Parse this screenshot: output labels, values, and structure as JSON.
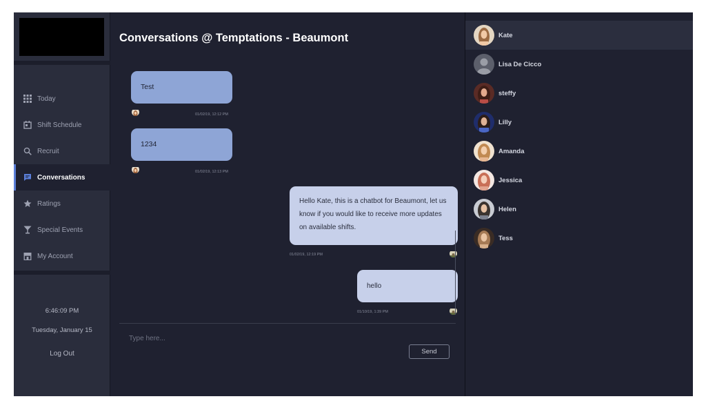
{
  "sidebar": {
    "nav": [
      {
        "label": "Today",
        "icon": "grid-icon"
      },
      {
        "label": "Shift Schedule",
        "icon": "calendar-icon"
      },
      {
        "label": "Recruit",
        "icon": "search-icon"
      },
      {
        "label": "Conversations",
        "icon": "chat-icon",
        "active": true
      },
      {
        "label": "Ratings",
        "icon": "star-icon"
      },
      {
        "label": "Special Events",
        "icon": "cocktail-icon"
      },
      {
        "label": "My Account",
        "icon": "store-icon"
      }
    ],
    "clock": "6:46:09 PM",
    "date": "Tuesday, January 15",
    "logout": "Log Out"
  },
  "main": {
    "title": "Conversations @ Temptations - Beaumont",
    "messages": [
      {
        "direction": "in",
        "text": "Test",
        "timestamp": "01/02/19, 12:12 PM"
      },
      {
        "direction": "in",
        "text": "1234",
        "timestamp": "01/02/19, 12:13 PM"
      },
      {
        "direction": "out",
        "text": "Hello Kate, this is a chatbot for Beaumont, let us know if you would like to receive more updates on available shifts.",
        "timestamp": "01/02/19, 12:19 PM"
      },
      {
        "direction": "out",
        "text": "hello",
        "timestamp": "01/10/19, 1:39 PM"
      }
    ],
    "compose": {
      "placeholder": "Type here...",
      "send_label": "Send"
    }
  },
  "contacts": [
    {
      "name": "Kate",
      "selected": true,
      "color": "#c79b73"
    },
    {
      "name": "Lisa De Cicco",
      "color": "#6b6e78",
      "placeholder": true
    },
    {
      "name": "steffy",
      "color": "#8a4a3c"
    },
    {
      "name": "Lilly",
      "color": "#3b4f8a"
    },
    {
      "name": "Amanda",
      "color": "#d6a77a"
    },
    {
      "name": "Jessica",
      "color": "#d88b74"
    },
    {
      "name": "Helen",
      "color": "#9aa0ad"
    },
    {
      "name": "Tess",
      "color": "#b08765"
    }
  ],
  "colors": {
    "background": "#1f2130",
    "sidebar": "#2a2d3c",
    "incoming_bubble": "#8ea5d6",
    "outgoing_bubble": "#c7d0ea",
    "accent": "#5b7fd9"
  }
}
